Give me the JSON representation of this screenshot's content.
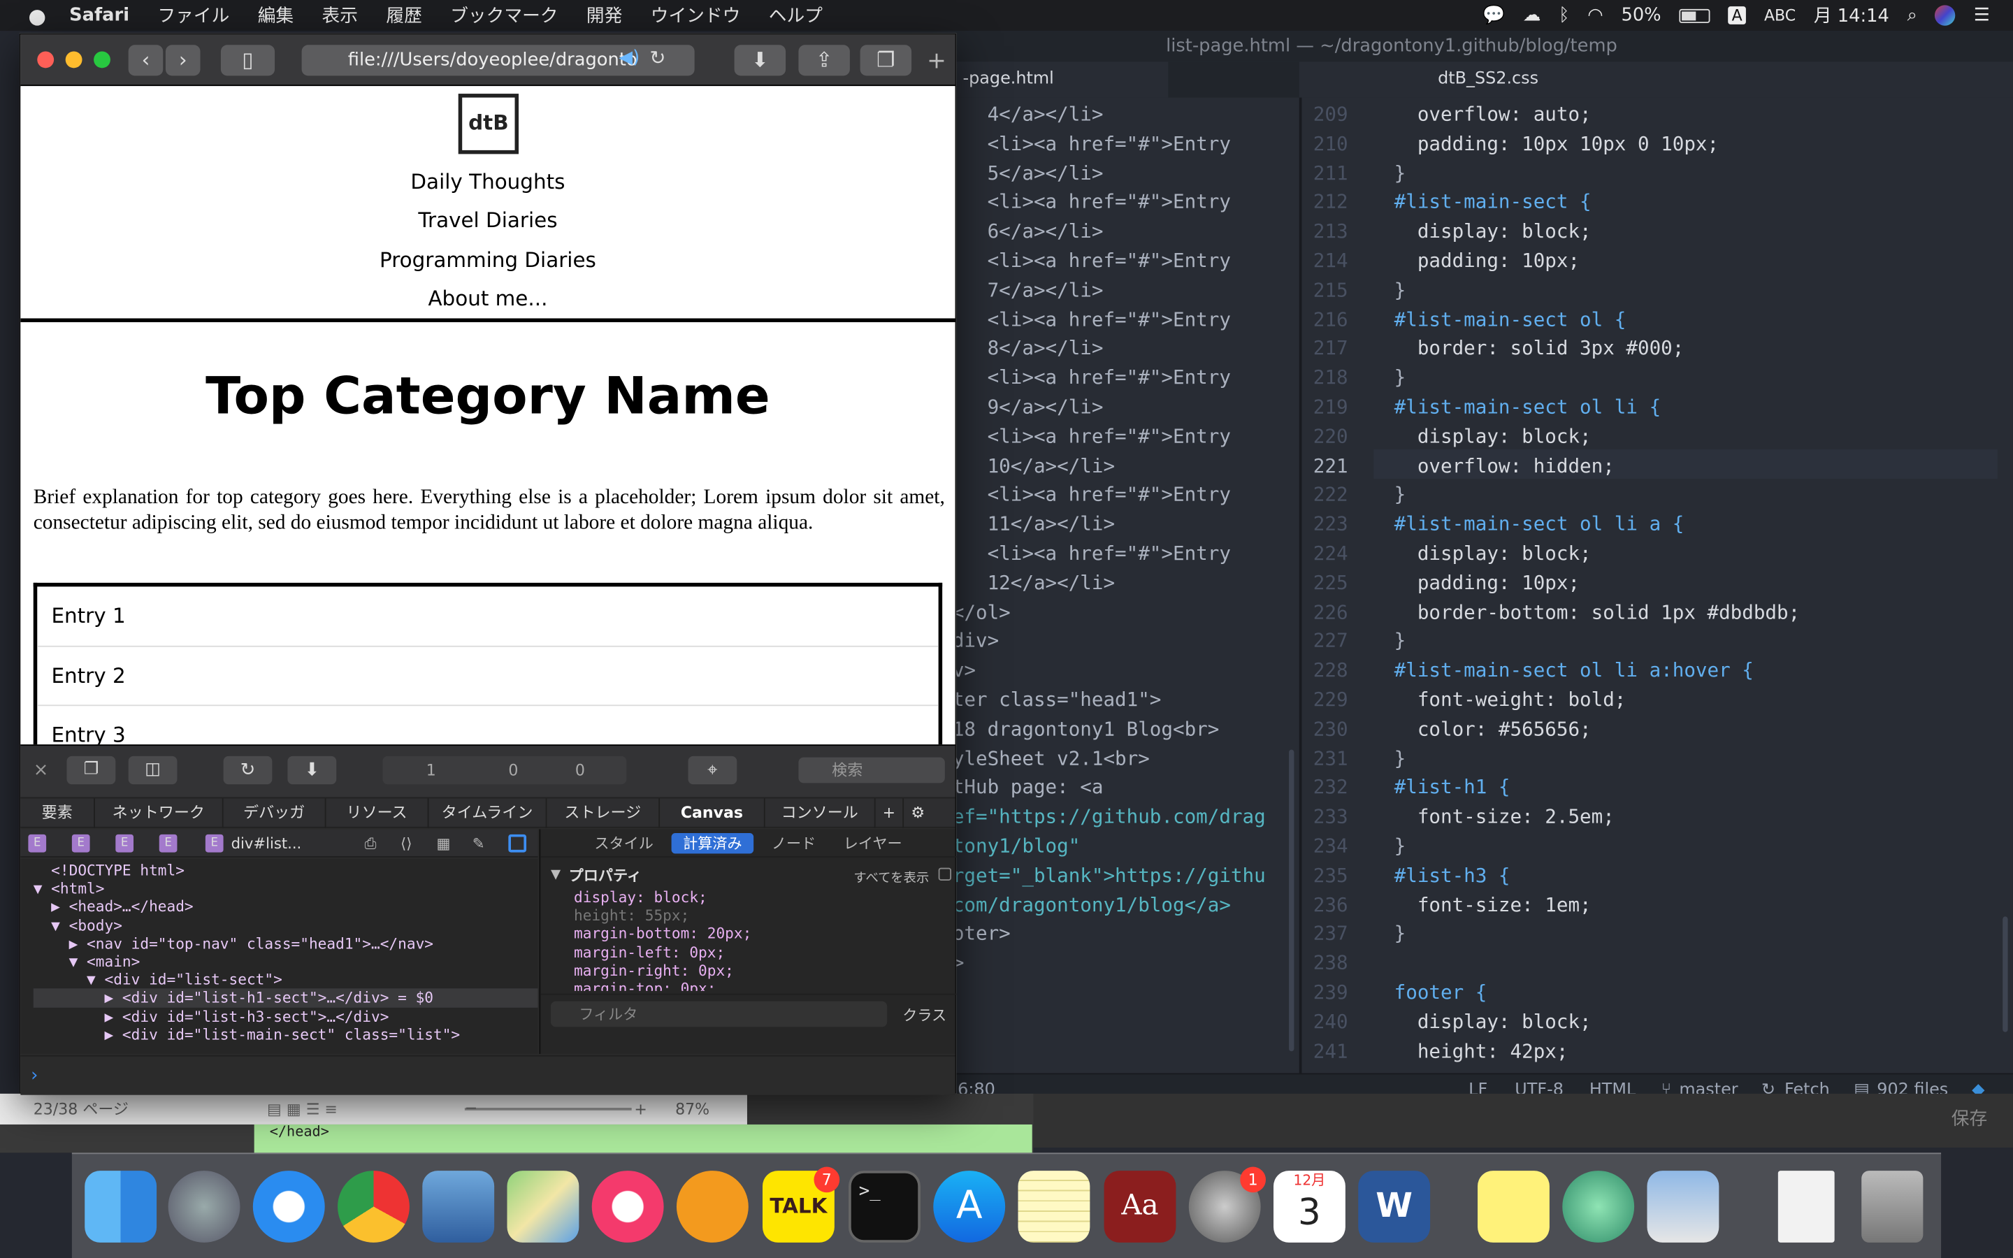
{
  "menubar": {
    "apple": "",
    "app_name": "Safari",
    "menus": [
      "ファイル",
      "編集",
      "表示",
      "履歴",
      "ブックマーク",
      "開発",
      "ウインドウ",
      "ヘルプ"
    ],
    "battery": "50%",
    "input": "ABC",
    "input_badge": "A",
    "clock": "月 14:14"
  },
  "editor": {
    "window_title": "list-page.html — ~/dragontony1.github/blog/temp",
    "tab_left": "-page.html",
    "tab_right": "dtB_SS2.css",
    "left_code": [
      "   4</a></li>",
      "   <li><a href=\"#\">Entry",
      "   5</a></li>",
      "   <li><a href=\"#\">Entry",
      "   6</a></li>",
      "   <li><a href=\"#\">Entry",
      "   7</a></li>",
      "   <li><a href=\"#\">Entry",
      "   8</a></li>",
      "   <li><a href=\"#\">Entry",
      "   9</a></li>",
      "   <li><a href=\"#\">Entry",
      "   10</a></li>",
      "   <li><a href=\"#\">Entry",
      "   11</a></li>",
      "   <li><a href=\"#\">Entry",
      "   12</a></li>",
      "</ol>",
      "div>",
      "v>",
      "ter class=\"head1\">",
      "18 dragontony1 Blog<br>",
      "yleSheet v2.1<br>",
      "tHub page: <a",
      "ef=\"https://github.com/drag",
      "tony1/blog\"",
      "rget=\"_blank\">https://githu",
      "com/dragontony1/blog</a>",
      "oter>",
      ">"
    ],
    "line_numbers": [
      "209",
      "210",
      "211",
      "212",
      "213",
      "214",
      "215",
      "216",
      "217",
      "218",
      "219",
      "220",
      "221",
      "222",
      "223",
      "224",
      "225",
      "226",
      "227",
      "228",
      "229",
      "230",
      "231",
      "232",
      "233",
      "234",
      "235",
      "236",
      "237",
      "238",
      "239",
      "240",
      "241"
    ],
    "right_code": [
      "  overflow: auto;",
      "  padding: 10px 10px 0 10px;",
      "}",
      "#list-main-sect {",
      "  display: block;",
      "  padding: 10px;",
      "}",
      "#list-main-sect ol {",
      "  border: solid 3px #000;",
      "}",
      "#list-main-sect ol li {",
      "  display: block;",
      "  overflow: hidden;",
      "}",
      "#list-main-sect ol li a {",
      "  display: block;",
      "  padding: 10px;",
      "  border-bottom: solid 1px #dbdbdb;",
      "}",
      "#list-main-sect ol li a:hover {",
      "  font-weight: bold;",
      "  color: #565656;",
      "}",
      "#list-h1 {",
      "  font-size: 2.5em;",
      "}",
      "#list-h3 {",
      "  font-size: 1em;",
      "}",
      "",
      "footer {",
      "  display: block;",
      "  height: 42px;"
    ],
    "status_cursor": "6:80",
    "status_items": [
      "LF",
      "UTF-8",
      "HTML",
      "master",
      "Fetch",
      "902 files"
    ],
    "save_label": "保存"
  },
  "safari": {
    "url": "file:///Users/doyeoplee/dragonto",
    "page": {
      "logo": "dtB",
      "nav": [
        "Daily Thoughts",
        "Travel Diaries",
        "Programming Diaries",
        "About me..."
      ],
      "heading": "Top Category Name",
      "paragraph": "Brief explanation for top category goes here. Everything else is a placeholder; Lorem ipsum dolor sit amet, consectetur adipiscing elit, sed do eiusmod tempor incididunt ut labore et dolore magna aliqua.",
      "entries": [
        "Entry 1",
        "Entry 2",
        "Entry 3"
      ]
    }
  },
  "devtools": {
    "resources_count": "1",
    "errors_count": "0",
    "warnings_count": "0",
    "search_placeholder": "検索",
    "tabs": [
      "要素",
      "ネットワーク",
      "デバッガ",
      "リソース",
      "タイムライン",
      "ストレージ",
      "Canvas",
      "コンソール"
    ],
    "breadcrumb_last": "div#list...",
    "side_tabs": [
      "スタイル",
      "計算済み",
      "ノード",
      "レイヤー"
    ],
    "properties_title": "プロパティ",
    "show_all": "すべてを表示",
    "filter_placeholder": "フィルタ",
    "class_label": "クラス",
    "computed": [
      {
        "text": "display: block;",
        "dim": false
      },
      {
        "text": "height: 55px;",
        "dim": true
      },
      {
        "text": "margin-bottom: 20px;",
        "dim": false
      },
      {
        "text": "margin-left: 0px;",
        "dim": false
      },
      {
        "text": "margin-right: 0px;",
        "dim": false
      },
      {
        "text": "margin-top: 0px;",
        "dim": false
      }
    ],
    "dom_lines": [
      "  <!DOCTYPE html>",
      "▼ <html>",
      "  ▶ <head>…</head>",
      "  ▼ <body>",
      "    ▶ <nav id=\"top-nav\" class=\"head1\">…</nav>",
      "    ▼ <main>",
      "      ▼ <div id=\"list-sect\">",
      "        ▶ <div id=\"list-h1-sect\">…</div> = $0",
      "        ▶ <div id=\"list-h3-sect\">…</div>",
      "        ▶ <div id=\"list-main-sect\" class=\"list\">"
    ]
  },
  "preview_window": {
    "page_label": "23/38 ページ",
    "zoom": "87%",
    "head_text": "</head>"
  },
  "dock": {
    "badges": {
      "kakaotalk": "7",
      "system_prefs": "1",
      "calendar_month": "12月",
      "calendar_day": "3"
    },
    "talk_label": "TALK"
  }
}
